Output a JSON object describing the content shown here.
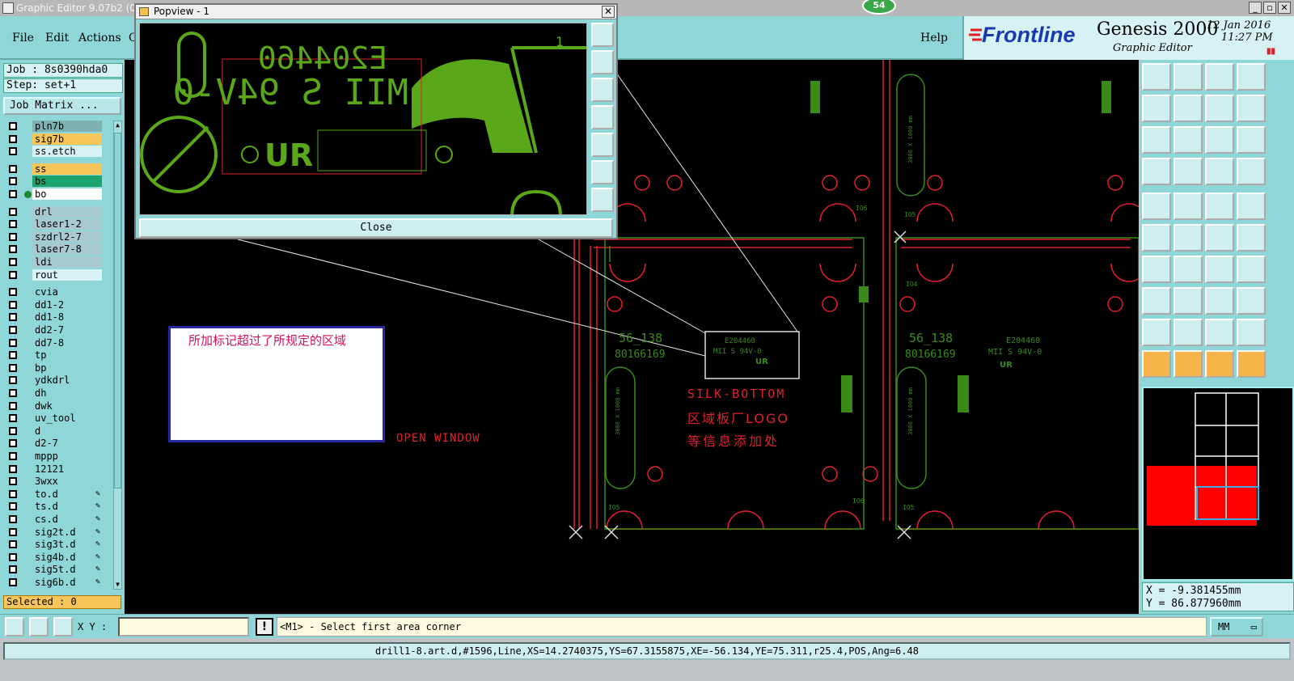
{
  "window": {
    "title": "Graphic Editor 9.07b2 (00(",
    "badge": "54"
  },
  "menu": {
    "file": "File",
    "edit": "Edit",
    "actions": "Actions",
    "partial": "O",
    "help": "Help"
  },
  "brand": {
    "logo": "Frontline",
    "product": "Genesis 2000",
    "subtitle": "Graphic Editor",
    "date": "12 Jan 2016",
    "time": "11:27 PM"
  },
  "job": {
    "job_line": "Job : 8s0390hda0",
    "step_line": "Step: set+1",
    "matrix_button": "Job Matrix ..."
  },
  "layers": [
    {
      "name": "pln7b",
      "color": "#7fb3b3"
    },
    {
      "name": "sig7b",
      "color": "#f7c65a"
    },
    {
      "name": "ss.etch",
      "color": "#d7f2f2"
    },
    {
      "name": "ss",
      "color": "#f7c65a"
    },
    {
      "name": "bs",
      "color": "#1aa36a"
    },
    {
      "name": "bo",
      "color": "#ffffff"
    },
    {
      "name": "drl",
      "color": "#a9c9d1"
    },
    {
      "name": "laser1-2",
      "color": "#a9c9d1"
    },
    {
      "name": "szdrl2-7",
      "color": "#a9c9d1"
    },
    {
      "name": "laser7-8",
      "color": "#a9c9d1"
    },
    {
      "name": "ldi",
      "color": "#a9c9d1"
    },
    {
      "name": "rout",
      "color": "#d7f2f2"
    },
    {
      "name": "cvia",
      "color": "#8fd6d8"
    },
    {
      "name": "dd1-2",
      "color": "#8fd6d8"
    },
    {
      "name": "dd1-8",
      "color": "#8fd6d8"
    },
    {
      "name": "dd2-7",
      "color": "#8fd6d8"
    },
    {
      "name": "dd7-8",
      "color": "#8fd6d8"
    },
    {
      "name": "tp",
      "color": "#8fd6d8"
    },
    {
      "name": "bp",
      "color": "#8fd6d8"
    },
    {
      "name": "ydkdrl",
      "color": "#8fd6d8"
    },
    {
      "name": "dh",
      "color": "#8fd6d8"
    },
    {
      "name": "dwk",
      "color": "#8fd6d8"
    },
    {
      "name": "uv_tool",
      "color": "#8fd6d8"
    },
    {
      "name": "d",
      "color": "#8fd6d8"
    },
    {
      "name": "d2-7",
      "color": "#8fd6d8"
    },
    {
      "name": "mppp",
      "color": "#8fd6d8"
    },
    {
      "name": "12121",
      "color": "#8fd6d8"
    },
    {
      "name": "3wxx",
      "color": "#8fd6d8"
    },
    {
      "name": "to.d",
      "color": "#8fd6d8"
    },
    {
      "name": "ts.d",
      "color": "#8fd6d8"
    },
    {
      "name": "cs.d",
      "color": "#8fd6d8"
    },
    {
      "name": "sig2t.d",
      "color": "#8fd6d8"
    },
    {
      "name": "sig3t.d",
      "color": "#8fd6d8"
    },
    {
      "name": "sig4b.d",
      "color": "#8fd6d8"
    },
    {
      "name": "sig5t.d",
      "color": "#8fd6d8"
    },
    {
      "name": "sig6b.d",
      "color": "#8fd6d8"
    }
  ],
  "selected": "Selected : 0",
  "popview": {
    "title": "Popview - 1",
    "close_label": "Close",
    "text1": "E204460",
    "text2": "MII S 94V-0",
    "logo": "UR",
    "page": "1"
  },
  "canvas": {
    "note": "所加标记超过了所规定的区域",
    "open_window": "OPEN WINDOW",
    "silk1": "SILK-BOTTOM",
    "silk2": "区域板厂LOGO",
    "silk3": "等信息添加处",
    "mark_a": "56_138",
    "mark_b": "80166169",
    "mark_c": "E204460",
    "mark_d": "MII S 94V-0",
    "ref_a": "IO6",
    "ref_b": "IO5",
    "ref_c": "IO4",
    "ref_d": "3000 X 1000 mm"
  },
  "coords": {
    "x": "X =  -9.381455mm",
    "y": "Y =  86.877960mm"
  },
  "bottom": {
    "xy_label": "X Y :",
    "xy_value": "",
    "prompt": "<M1> - Select first area corner",
    "unit": "MM",
    "warn": "!"
  },
  "status": "drill1-8.art.d,#1596,Line,XS=14.2740375,YS=67.3155875,XE=-56.134,YE=75.311,r25.4,POS,Ang=6.48",
  "colors": {
    "panel": "#8fd6d8",
    "silk": "#3a8a1a",
    "outline": "#e0202a",
    "bright_green": "#5aa81a"
  }
}
